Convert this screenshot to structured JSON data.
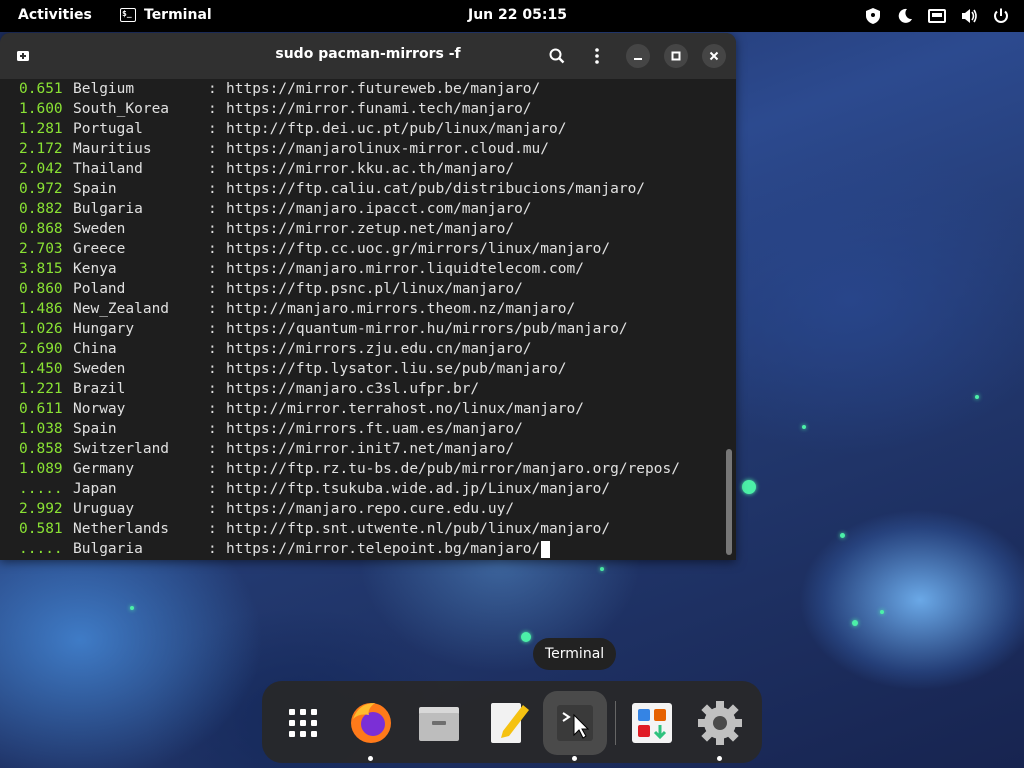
{
  "topbar": {
    "activities": "Activities",
    "app_name": "Terminal",
    "app_icon_text": "$_",
    "clock": "Jun 22  05:15",
    "tray_icons": [
      "privacy-icon",
      "night-light-icon",
      "network-icon",
      "volume-icon",
      "power-icon"
    ]
  },
  "terminal": {
    "title": "sudo pacman-mirrors -f",
    "rows": [
      {
        "speed": "0.651",
        "country": "Belgium",
        "colon": ":",
        "url": "https://mirror.futureweb.be/manjaro/"
      },
      {
        "speed": "1.600",
        "country": "South_Korea",
        "colon": ":",
        "url": "https://mirror.funami.tech/manjaro/"
      },
      {
        "speed": "1.281",
        "country": "Portugal",
        "colon": ":",
        "url": "http://ftp.dei.uc.pt/pub/linux/manjaro/"
      },
      {
        "speed": "2.172",
        "country": "Mauritius",
        "colon": ":",
        "url": "https://manjarolinux-mirror.cloud.mu/"
      },
      {
        "speed": "2.042",
        "country": "Thailand",
        "colon": ":",
        "url": "https://mirror.kku.ac.th/manjaro/"
      },
      {
        "speed": "0.972",
        "country": "Spain",
        "colon": ":",
        "url": "https://ftp.caliu.cat/pub/distribucions/manjaro/"
      },
      {
        "speed": "0.882",
        "country": "Bulgaria",
        "colon": ":",
        "url": "https://manjaro.ipacct.com/manjaro/"
      },
      {
        "speed": "0.868",
        "country": "Sweden",
        "colon": ":",
        "url": "https://mirror.zetup.net/manjaro/"
      },
      {
        "speed": "2.703",
        "country": "Greece",
        "colon": ":",
        "url": "https://ftp.cc.uoc.gr/mirrors/linux/manjaro/"
      },
      {
        "speed": "3.815",
        "country": "Kenya",
        "colon": ":",
        "url": "https://manjaro.mirror.liquidtelecom.com/"
      },
      {
        "speed": "0.860",
        "country": "Poland",
        "colon": ":",
        "url": "https://ftp.psnc.pl/linux/manjaro/"
      },
      {
        "speed": "1.486",
        "country": "New_Zealand",
        "colon": ":",
        "url": "http://manjaro.mirrors.theom.nz/manjaro/"
      },
      {
        "speed": "1.026",
        "country": "Hungary",
        "colon": ":",
        "url": "https://quantum-mirror.hu/mirrors/pub/manjaro/"
      },
      {
        "speed": "2.690",
        "country": "China",
        "colon": ":",
        "url": "https://mirrors.zju.edu.cn/manjaro/"
      },
      {
        "speed": "1.450",
        "country": "Sweden",
        "colon": ":",
        "url": "https://ftp.lysator.liu.se/pub/manjaro/"
      },
      {
        "speed": "1.221",
        "country": "Brazil",
        "colon": ":",
        "url": "https://manjaro.c3sl.ufpr.br/"
      },
      {
        "speed": "0.611",
        "country": "Norway",
        "colon": ":",
        "url": "http://mirror.terrahost.no/linux/manjaro/"
      },
      {
        "speed": "1.038",
        "country": "Spain",
        "colon": ":",
        "url": "https://mirrors.ft.uam.es/manjaro/"
      },
      {
        "speed": "0.858",
        "country": "Switzerland",
        "colon": ":",
        "url": "https://mirror.init7.net/manjaro/"
      },
      {
        "speed": "1.089",
        "country": "Germany",
        "colon": ":",
        "url": "http://ftp.rz.tu-bs.de/pub/mirror/manjaro.org/repos/"
      },
      {
        "speed": ".....",
        "country": "Japan",
        "colon": ":",
        "url": "http://ftp.tsukuba.wide.ad.jp/Linux/manjaro/"
      },
      {
        "speed": "2.992",
        "country": "Uruguay",
        "colon": ":",
        "url": "https://manjaro.repo.cure.edu.uy/"
      },
      {
        "speed": "0.581",
        "country": "Netherlands",
        "colon": ":",
        "url": "http://ftp.snt.utwente.nl/pub/linux/manjaro/"
      },
      {
        "speed": ".....",
        "country": "Bulgaria",
        "colon": ":",
        "url": "https://mirror.telepoint.bg/manjaro/"
      }
    ]
  },
  "tooltip": "Terminal",
  "dock": {
    "items": [
      "app-grid-icon",
      "firefox-icon",
      "files-icon",
      "text-editor-icon",
      "terminal-icon",
      "software-icon",
      "settings-icon"
    ]
  },
  "colors": {
    "speed_green": "#8ae234",
    "terminal_bg": "#1e1e1e",
    "titlebar_bg": "#303030"
  }
}
